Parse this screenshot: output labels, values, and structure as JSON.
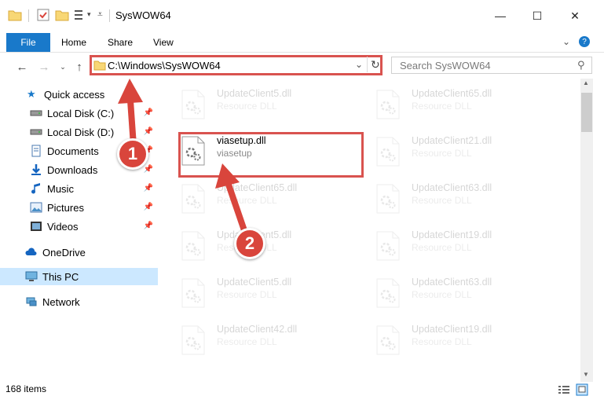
{
  "window": {
    "title": "SysWOW64",
    "minimize": "—",
    "maximize": "☐",
    "close": "✕"
  },
  "ribbon": {
    "file": "File",
    "home": "Home",
    "share": "Share",
    "view": "View"
  },
  "address": {
    "path": "C:\\Windows\\SysWOW64",
    "search_placeholder": "Search SysWOW64"
  },
  "sidebar": {
    "quick_access": "Quick access",
    "items": [
      {
        "label": "Local Disk (C:)",
        "icon": "drive-icon",
        "pinned": true
      },
      {
        "label": "Local Disk (D:)",
        "icon": "drive-icon",
        "pinned": true
      },
      {
        "label": "Documents",
        "icon": "documents-icon",
        "pinned": true
      },
      {
        "label": "Downloads",
        "icon": "downloads-icon",
        "pinned": true
      },
      {
        "label": "Music",
        "icon": "music-icon",
        "pinned": true
      },
      {
        "label": "Pictures",
        "icon": "pictures-icon",
        "pinned": true
      },
      {
        "label": "Videos",
        "icon": "videos-icon",
        "pinned": true
      }
    ],
    "onedrive": "OneDrive",
    "this_pc": "This PC",
    "network": "Network"
  },
  "files": {
    "highlighted": {
      "name": "viasetup.dll",
      "desc": "viasetup"
    },
    "col1": [
      {
        "name": "UpdateClient5.dll",
        "desc": "Resource DLL"
      },
      {
        "name": "UpdateClient65.dll",
        "desc": "Resource DLL"
      },
      {
        "name": "UpdateClient5.dll",
        "desc": "Resource DLL"
      },
      {
        "name": "UpdateClient5.dll",
        "desc": "Resource DLL"
      },
      {
        "name": "UpdateClient42.dll",
        "desc": "Resource DLL"
      }
    ],
    "col2": [
      {
        "name": "UpdateClient65.dll",
        "desc": "Resource DLL"
      },
      {
        "name": "UpdateClient21.dll",
        "desc": "Resource DLL"
      },
      {
        "name": "UpdateClient63.dll",
        "desc": "Resource DLL"
      },
      {
        "name": "UpdateClient19.dll",
        "desc": "Resource DLL"
      },
      {
        "name": "UpdateClient63.dll",
        "desc": "Resource DLL"
      },
      {
        "name": "UpdateClient19.dll",
        "desc": "Resource DLL"
      }
    ]
  },
  "status": {
    "count": "168 items"
  },
  "callouts": {
    "one": "1",
    "two": "2"
  },
  "colors": {
    "accent": "#1979ca",
    "highlight": "#d9534f",
    "callout": "#d9453c"
  }
}
